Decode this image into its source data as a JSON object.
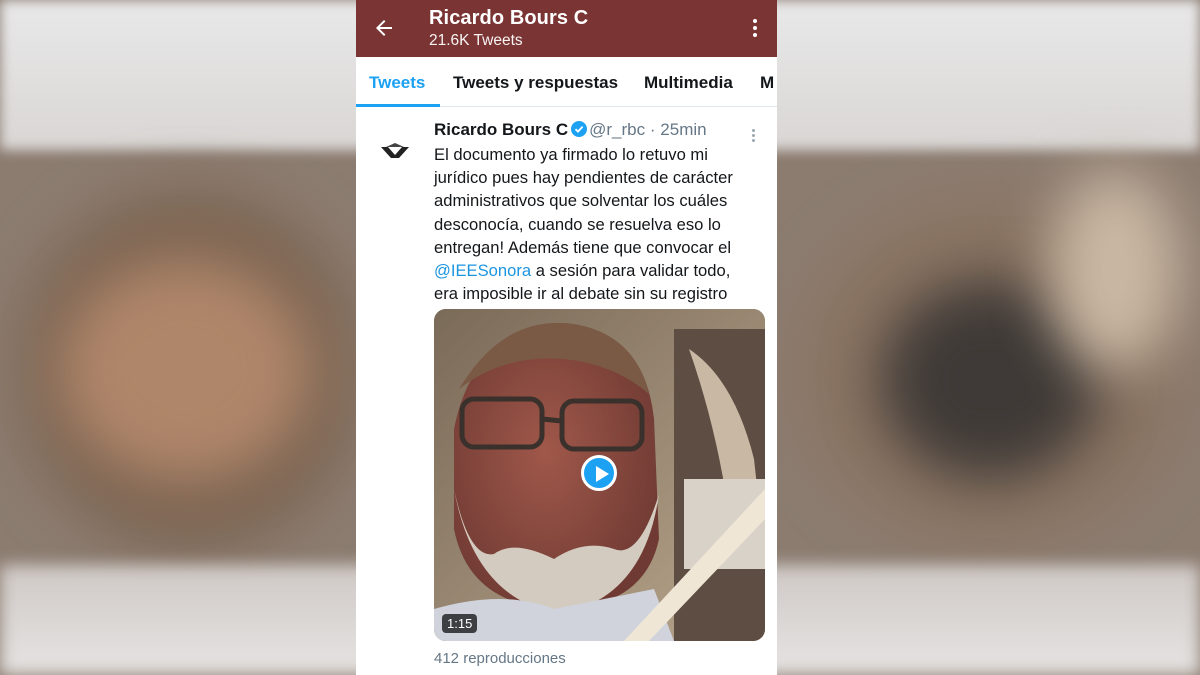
{
  "header": {
    "title": "Ricardo Bours C",
    "subtitle": "21.6K Tweets",
    "back_icon": "back-arrow-icon",
    "menu_icon": "more-vertical-icon",
    "color": "#7a3433"
  },
  "tabs": [
    {
      "label": "Tweets",
      "active": true
    },
    {
      "label": "Tweets y respuestas",
      "active": false
    },
    {
      "label": "Multimedia",
      "active": false
    },
    {
      "label": "M",
      "active": false
    }
  ],
  "tweet": {
    "name": "Ricardo Bours C",
    "handle": "@r_rbc",
    "separator": "·",
    "time": "25min",
    "text_lines": [
      "El documento ya firmado lo retuvo mi",
      "jurídico pues hay pendientes de carácter",
      "administrativos que solventar los cuáles",
      "desconocía, cuando se resuelva eso lo",
      "entregan! Además tiene que convocar el"
    ],
    "mention": "@IEESonora",
    "text_after_mention": " a sesión para validar todo,",
    "text_last": "era imposible ir al debate sin su registro",
    "video_duration": "1:15",
    "views": "412 reproducciones",
    "accent_color": "#1da1f2"
  }
}
